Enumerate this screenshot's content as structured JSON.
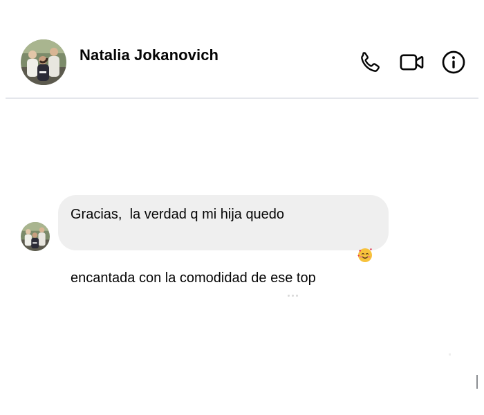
{
  "conversation": {
    "contact_name": "Natalia Jokanovich",
    "header_icons": [
      "phone-icon",
      "video-camera-icon",
      "info-icon"
    ],
    "accent_color": "#050505"
  },
  "message": {
    "line1": "Gracias,  la verdad q mi hija quedo",
    "line2": "encantada con la comodidad de ese top",
    "emoji": "smiling-face-with-hearts-icon",
    "bubble_color": "#efefef"
  }
}
